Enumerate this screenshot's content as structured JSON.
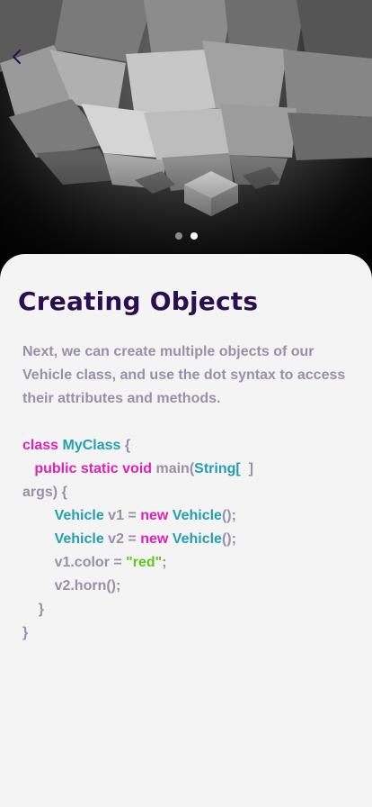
{
  "nav": {
    "back_icon": "chevron-left-icon"
  },
  "carousel": {
    "total_pages": 2,
    "active_page": 2
  },
  "colors": {
    "title": "#2a0e52",
    "text": "#9a8fa8",
    "keyword": "#e021b8",
    "type": "#239fb4",
    "string": "#5bc81e",
    "sheet_bg": "#f4f4f4"
  },
  "content": {
    "title": "Creating Objects",
    "description": "Next, we can create multiple objects of our Vehicle class, and use the dot syntax to access their attributes and methods."
  },
  "code": {
    "lines": [
      [
        {
          "t": "kw",
          "v": "class"
        },
        {
          "t": "plain",
          "v": " "
        },
        {
          "t": "type",
          "v": "MyClass"
        },
        {
          "t": "plain",
          "v": " {"
        }
      ],
      [
        {
          "t": "plain",
          "v": "   "
        },
        {
          "t": "kw",
          "v": "public static void"
        },
        {
          "t": "plain",
          "v": " main("
        },
        {
          "t": "type",
          "v": "String["
        },
        {
          "t": "plain",
          "v": "  ]"
        }
      ],
      [
        {
          "t": "plain",
          "v": "args) {"
        }
      ],
      [
        {
          "t": "plain",
          "v": "        "
        },
        {
          "t": "type",
          "v": "Vehicle"
        },
        {
          "t": "plain",
          "v": " v1 = "
        },
        {
          "t": "kw",
          "v": "new"
        },
        {
          "t": "plain",
          "v": " "
        },
        {
          "t": "type",
          "v": "Vehicle"
        },
        {
          "t": "plain",
          "v": "();"
        }
      ],
      [
        {
          "t": "plain",
          "v": "        "
        },
        {
          "t": "type",
          "v": "Vehicle"
        },
        {
          "t": "plain",
          "v": " v2 = "
        },
        {
          "t": "kw",
          "v": "new"
        },
        {
          "t": "plain",
          "v": " "
        },
        {
          "t": "type",
          "v": "Vehicle"
        },
        {
          "t": "plain",
          "v": "();"
        }
      ],
      [
        {
          "t": "plain",
          "v": "        v1.color = "
        },
        {
          "t": "str",
          "v": "\"red\""
        },
        {
          "t": "plain",
          "v": ";"
        }
      ],
      [
        {
          "t": "plain",
          "v": "        v2.horn();"
        }
      ],
      [
        {
          "t": "plain",
          "v": "    }"
        }
      ],
      [
        {
          "t": "plain",
          "v": "}"
        }
      ]
    ]
  }
}
